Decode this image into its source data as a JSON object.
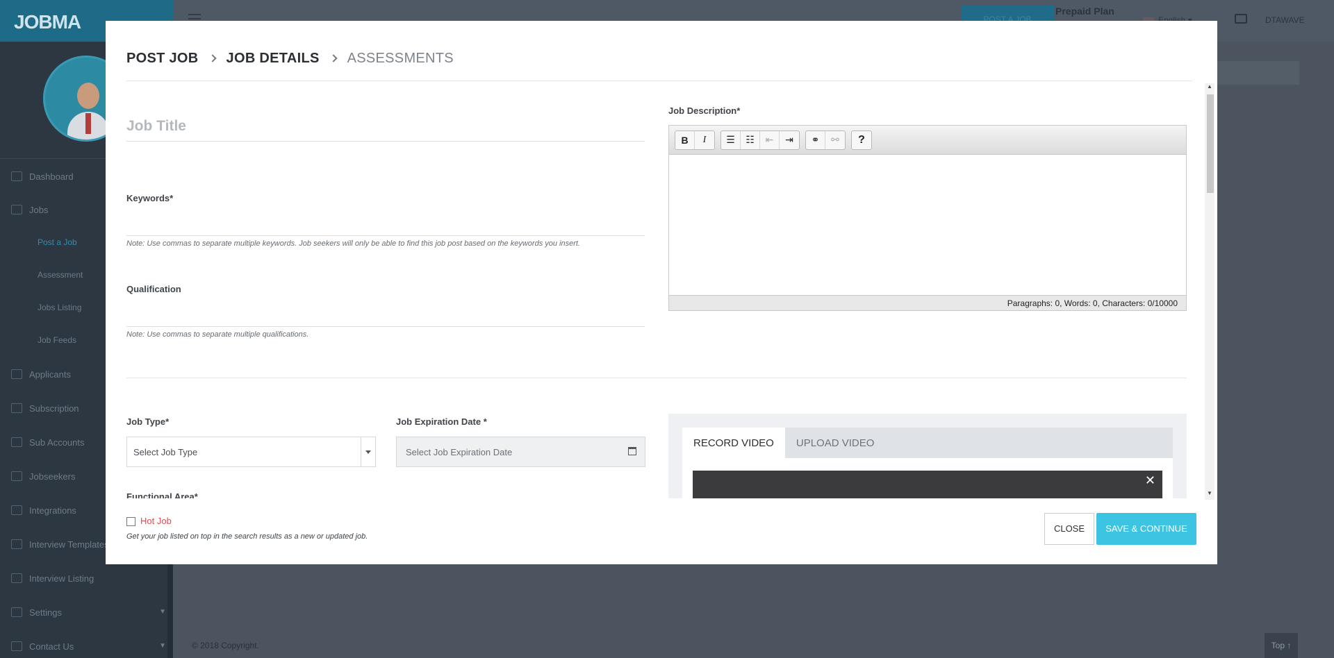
{
  "app": {
    "logo_text": "JOBMA"
  },
  "sidebar": {
    "items": [
      {
        "label": "Dashboard",
        "icon": "bar-chart-icon"
      },
      {
        "label": "Jobs",
        "icon": "briefcase-icon"
      },
      {
        "label": "Applicants",
        "icon": "users-icon"
      },
      {
        "label": "Subscription",
        "icon": "card-icon"
      },
      {
        "label": "Sub Accounts",
        "icon": "user-group-icon"
      },
      {
        "label": "Jobseekers",
        "icon": "globe-icon"
      },
      {
        "label": "Integrations",
        "icon": "share-icon"
      },
      {
        "label": "Interview Templates",
        "icon": "template-icon"
      },
      {
        "label": "Interview Listing",
        "icon": "list-icon"
      },
      {
        "label": "Settings",
        "icon": "gear-icon"
      },
      {
        "label": "Contact Us",
        "icon": "home-icon"
      }
    ],
    "subitems": [
      {
        "label": "Post a Job",
        "active": true
      },
      {
        "label": "Assessment"
      },
      {
        "label": "Jobs Listing"
      },
      {
        "label": "Job Feeds"
      }
    ]
  },
  "topbar": {
    "post_job_label": "POST A JOB",
    "plan_label": "Prepaid Plan",
    "language": "English",
    "user_name": "DTAWAVE"
  },
  "footer": {
    "copyright": "© 2018 Copyright.",
    "top_label": "Top ↑"
  },
  "modal": {
    "breadcrumb": [
      "POST JOB",
      "JOB DETAILS",
      "ASSESSMENTS"
    ],
    "job_title_placeholder": "Job Title",
    "keywords_label": "Keywords*",
    "keywords_note": "Note: Use commas to separate multiple keywords. Job seekers will only be able to find this job post based on the keywords you insert.",
    "qualification_label": "Qualification",
    "qualification_note": "Note: Use commas to separate multiple qualifications.",
    "description_label": "Job Description*",
    "editor_status": "Paragraphs: 0, Words: 0, Characters: 0/10000",
    "job_type_label": "Job Type*",
    "job_type_placeholder": "Select Job Type",
    "expiration_label": "Job Expiration Date *",
    "expiration_placeholder": "Select Job Expiration Date",
    "functional_area_label": "Functional Area*",
    "video_tabs": [
      "RECORD VIDEO",
      "UPLOAD VIDEO"
    ],
    "hot_job_label": "Hot Job",
    "hot_job_note": "Get your job listed on top in the search results as a new or updated job.",
    "close_label": "CLOSE",
    "save_label": "SAVE & CONTINUE"
  },
  "colors": {
    "accent": "#3ec4e3",
    "hot": "#e14c55",
    "overlay": "#4c5460"
  }
}
